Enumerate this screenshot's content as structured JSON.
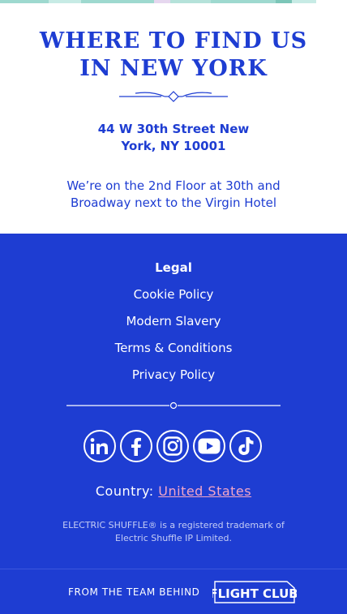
{
  "find_us": {
    "title_line1": "WHERE TO FIND US",
    "title_line2": "IN NEW YORK",
    "address_line1": "44 W 30th Street New",
    "address_line2": "York, NY 10001",
    "location_note": "We’re on the 2nd Floor at 30th and Broadway next to the Virgin Hotel"
  },
  "footer": {
    "legal_heading": "Legal",
    "legal_links": [
      "Cookie Policy",
      "Modern Slavery",
      "Terms & Conditions",
      "Privacy Policy"
    ],
    "social_icons": [
      "linkedin-icon",
      "facebook-icon",
      "instagram-icon",
      "youtube-icon",
      "tiktok-icon"
    ],
    "country_label": "Country:",
    "country_value": "United States",
    "trademark": "ELECTRIC SHUFFLE® is a registered trademark of Electric Shuffle IP Limited."
  },
  "bottom_bar": {
    "from_team_text": "FROM THE TEAM BEHIND",
    "logo_text": "FLIGHT CLUB"
  },
  "colors": {
    "brand_blue": "#1e3dd2",
    "link_pink": "#f4a6c6",
    "white": "#ffffff",
    "strip_teal": "#9ed9cf"
  }
}
